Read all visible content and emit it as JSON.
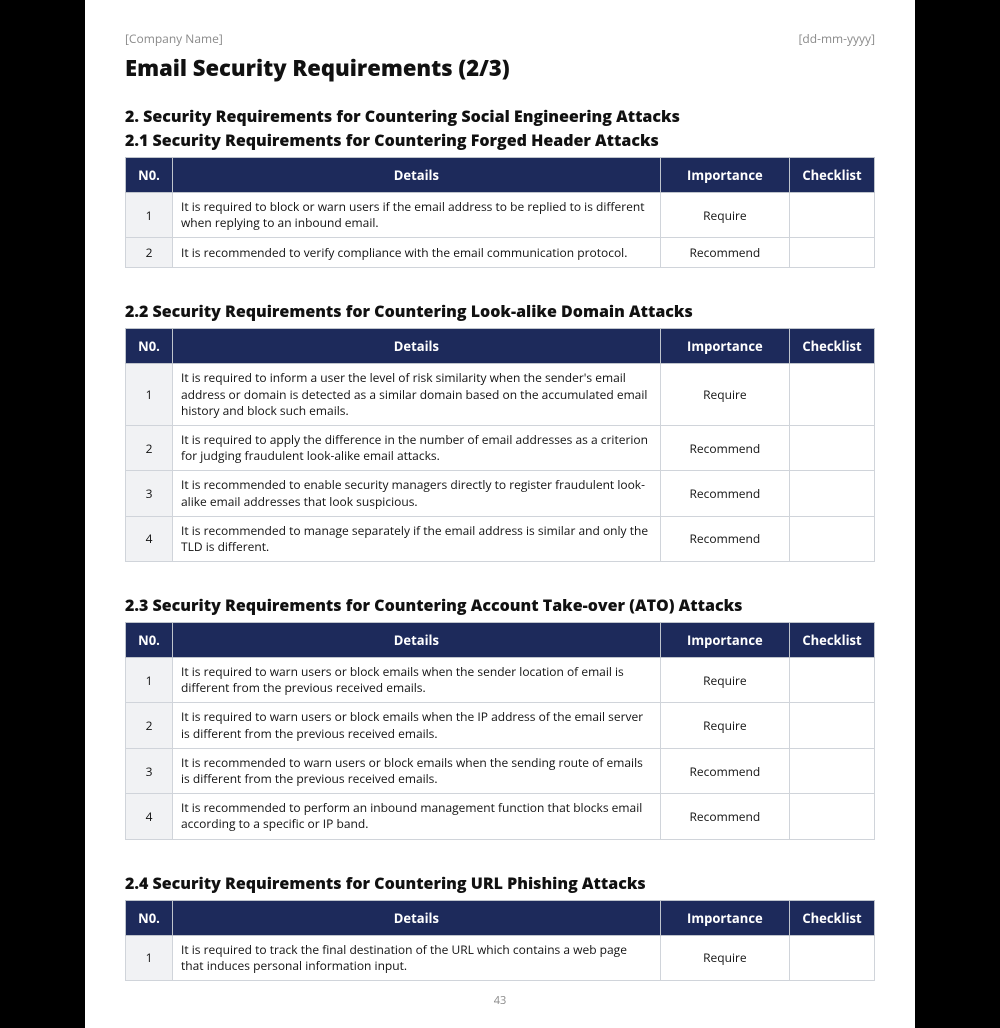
{
  "header": {
    "company": "[Company Name]",
    "date": "[dd-mm-yyyy]"
  },
  "title": "Email Security Requirements (2/3)",
  "section_heading": "2. Security Requirements for Countering Social Engineering Attacks",
  "columns": {
    "no": "N0.",
    "details": "Details",
    "importance": "Importance",
    "checklist": "Checklist"
  },
  "subsections": [
    {
      "heading": "2.1 Security Requirements for Countering Forged Header Attacks",
      "rows": [
        {
          "no": "1",
          "details": "It is required to block or warn users if the email address to be replied to is different when replying to an inbound email.",
          "importance": "Require",
          "checklist": ""
        },
        {
          "no": "2",
          "details": "It is recommended to verify compliance with the email communication protocol.",
          "importance": "Recommend",
          "checklist": ""
        }
      ]
    },
    {
      "heading": "2.2 Security Requirements for Countering Look-alike Domain Attacks",
      "rows": [
        {
          "no": "1",
          "details": "It is required to inform a user the level of risk similarity when the sender's email address or domain is detected as a similar domain based on the accumulated email history and block such emails.",
          "importance": "Require",
          "checklist": ""
        },
        {
          "no": "2",
          "details": "It is required to apply the difference in the number of email addresses as a criterion for judging fraudulent look-alike email attacks.",
          "importance": "Recommend",
          "checklist": ""
        },
        {
          "no": "3",
          "details": "It is recommended to enable security managers directly to register fraudulent look-alike email addresses that look suspicious.",
          "importance": "Recommend",
          "checklist": ""
        },
        {
          "no": "4",
          "details": "It is recommended to manage separately if the email address is similar and only the TLD is different.",
          "importance": "Recommend",
          "checklist": ""
        }
      ]
    },
    {
      "heading": "2.3 Security Requirements for Countering Account Take-over (ATO) Attacks",
      "rows": [
        {
          "no": "1",
          "details": "It is required to warn users or block emails when the sender location of email is different from the previous received emails.",
          "importance": "Require",
          "checklist": ""
        },
        {
          "no": "2",
          "details": "It is required to warn users or block emails when the IP address of the email server is different from the previous received emails.",
          "importance": "Require",
          "checklist": ""
        },
        {
          "no": "3",
          "details": "It is recommended to warn users or block emails when the sending route of emails is different from the previous received emails.",
          "importance": "Recommend",
          "checklist": ""
        },
        {
          "no": "4",
          "details": "It is recommended to perform an inbound management function that blocks email according to a specific or IP band.",
          "importance": "Recommend",
          "checklist": ""
        }
      ]
    },
    {
      "heading": "2.4 Security Requirements for Countering URL Phishing Attacks",
      "rows": [
        {
          "no": "1",
          "details": "It is required to track the final destination of the URL which contains a web page that induces personal information input.",
          "importance": "Require",
          "checklist": ""
        }
      ]
    }
  ],
  "page_number": "43"
}
